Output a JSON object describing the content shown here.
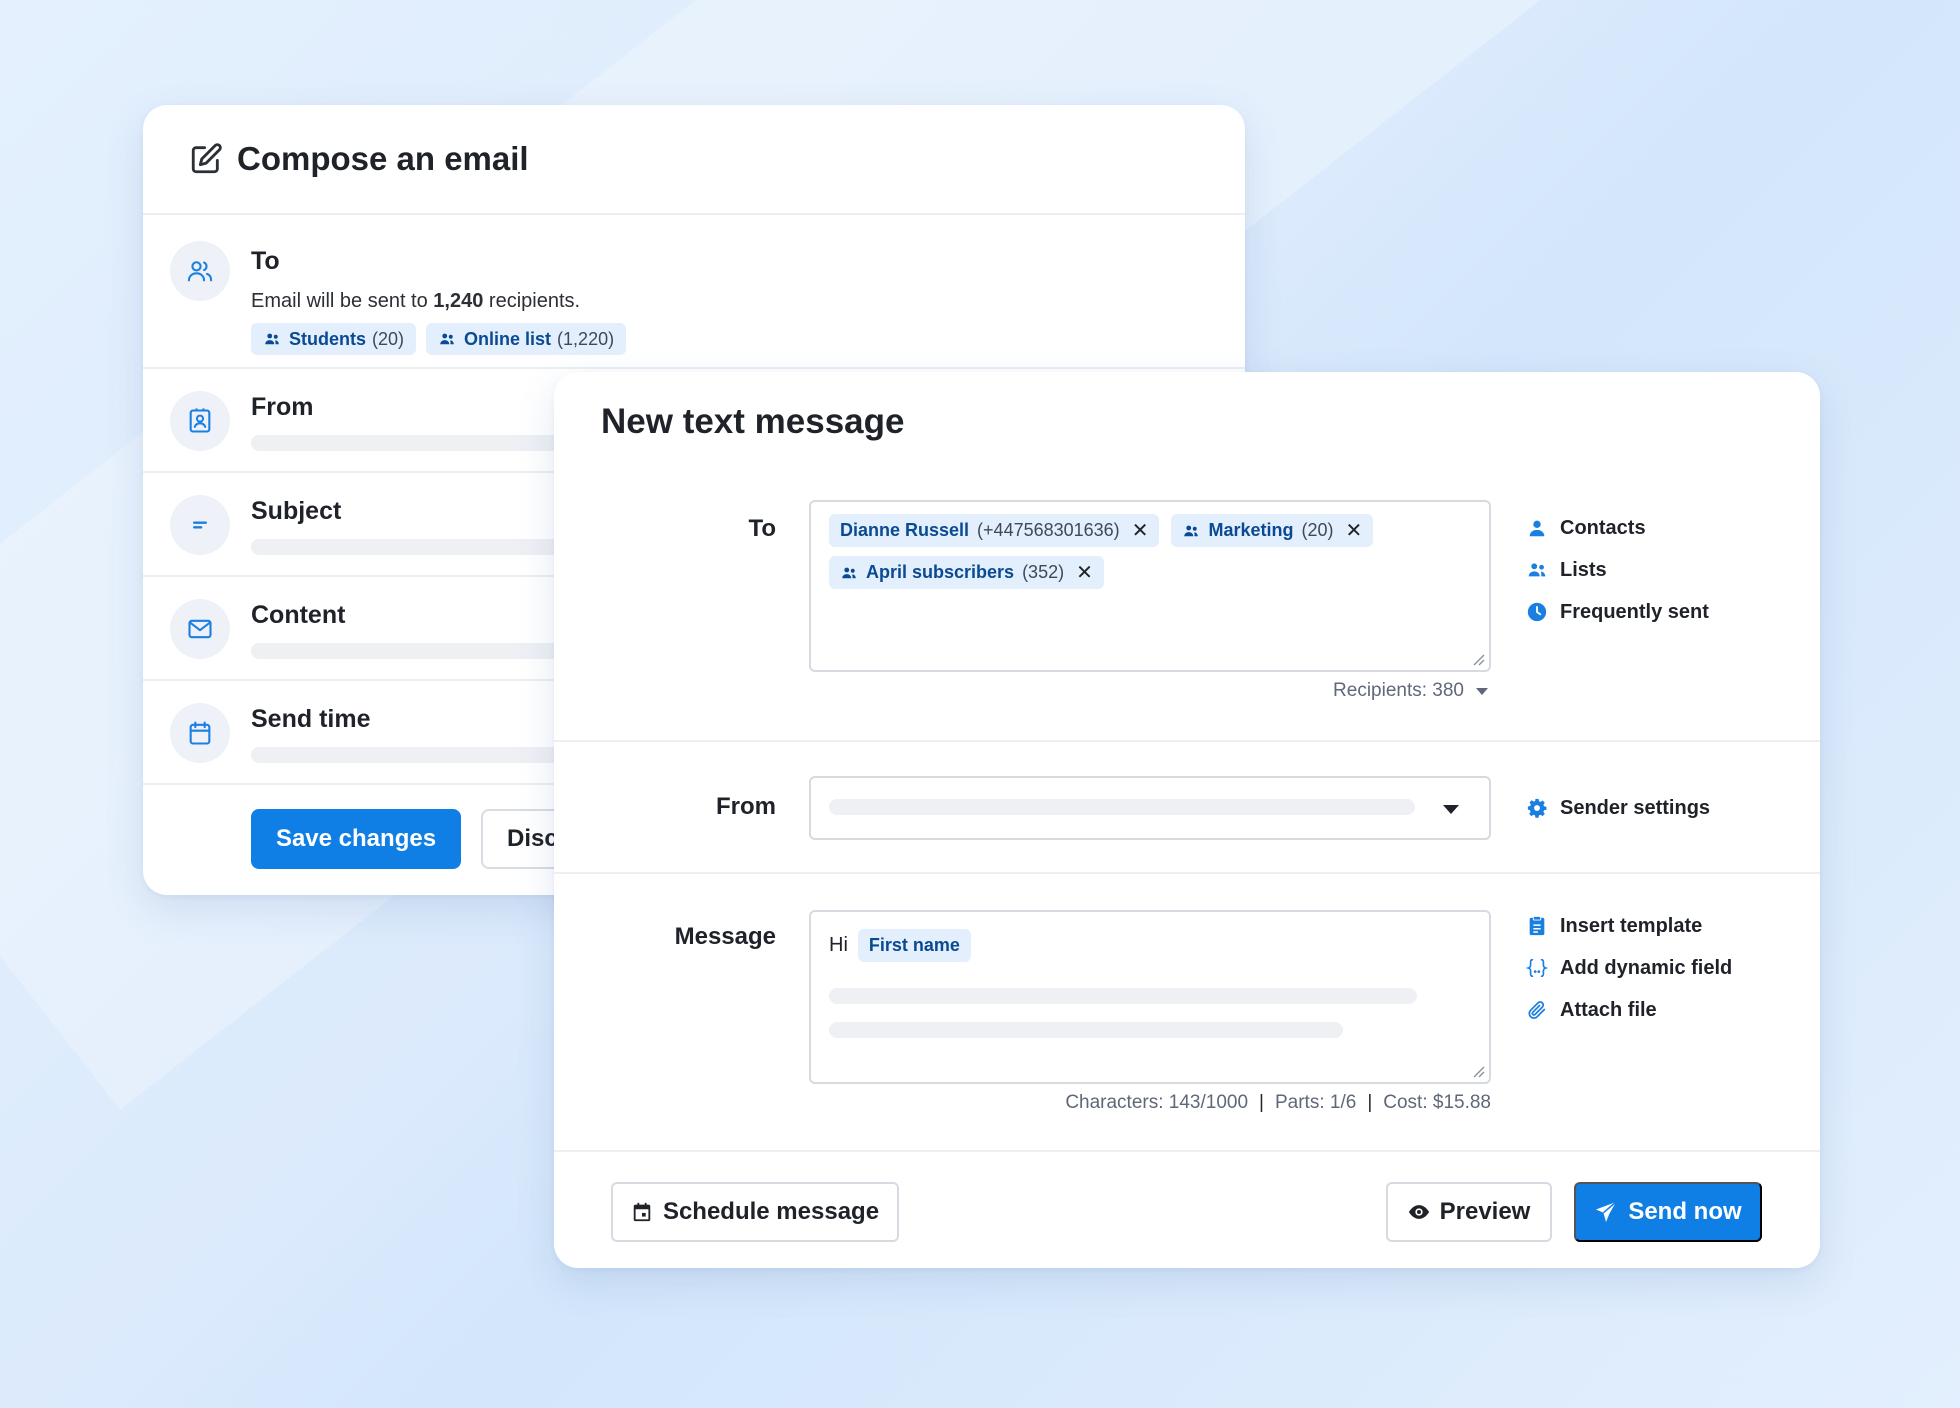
{
  "email": {
    "title": "Compose an email",
    "to": {
      "label": "To",
      "desc_prefix": "Email will be sent to ",
      "desc_count": "1,240",
      "desc_suffix": " recipients.",
      "chips": [
        {
          "name": "Students",
          "count": "(20)"
        },
        {
          "name": "Online list",
          "count": "(1,220)"
        }
      ]
    },
    "rows": {
      "from": "From",
      "subject": "Subject",
      "content": "Content",
      "send_time": "Send time"
    },
    "save_label": "Save changes",
    "discard_label": "Disc"
  },
  "sms": {
    "title": "New text message",
    "to": {
      "label": "To",
      "chips": [
        {
          "name": "Dianne Russell",
          "count": "(+447568301636)"
        },
        {
          "name": "Marketing",
          "count": "(20)"
        },
        {
          "name": "April subscribers",
          "count": "(352)"
        }
      ],
      "recipients": "Recipients: 380",
      "side": [
        "Contacts",
        "Lists",
        "Frequently sent"
      ]
    },
    "from": {
      "label": "From",
      "side": "Sender settings"
    },
    "message": {
      "label": "Message",
      "greeting": "Hi",
      "field_chip": "First name",
      "characters": "Characters: 143/1000",
      "parts": "Parts: 1/6",
      "cost": "Cost: $15.88",
      "side": [
        "Insert template",
        "Add dynamic field",
        "Attach file"
      ]
    },
    "footer": {
      "schedule": "Schedule message",
      "preview": "Preview",
      "send": "Send now"
    }
  },
  "colors": {
    "accent": "#0f7fe6",
    "chip_bg": "#e3effc",
    "chip_text": "#0a4a93"
  }
}
